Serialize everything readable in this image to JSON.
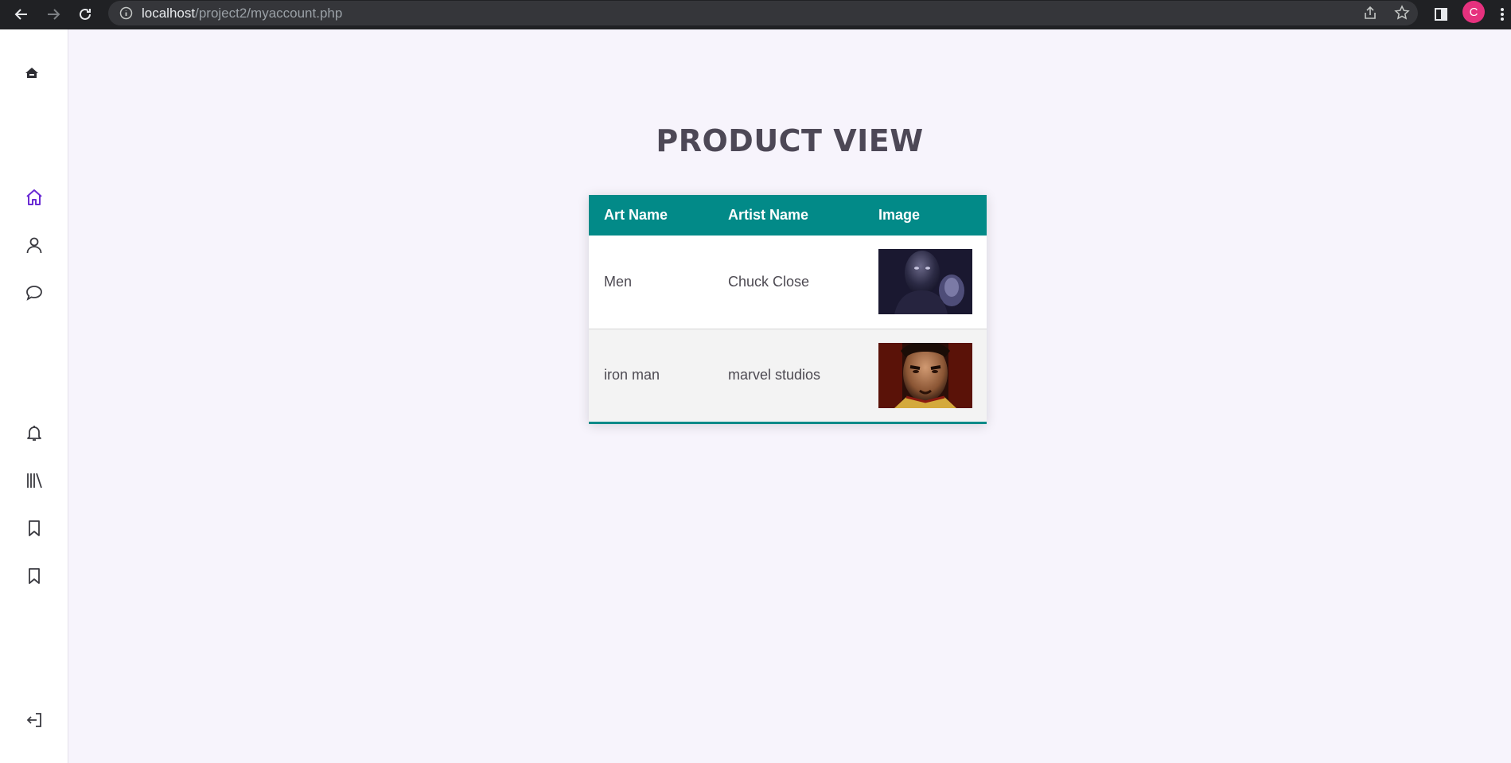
{
  "browser": {
    "url_host": "localhost",
    "url_path": "/project2/myaccount.php",
    "profile_initial": "C",
    "icons": [
      "back-icon",
      "forward-icon",
      "reload-icon",
      "info-icon",
      "share-icon",
      "star-icon",
      "side-panel-icon",
      "menu-icon"
    ]
  },
  "sidebar": {
    "items": [
      {
        "icon": "logo-icon"
      },
      {
        "icon": "home-icon",
        "color": "#6a2bd4"
      },
      {
        "icon": "user-icon"
      },
      {
        "icon": "chat-icon"
      },
      {
        "icon": "bell-icon"
      },
      {
        "icon": "library-icon"
      },
      {
        "icon": "bookmark-icon"
      },
      {
        "icon": "bookmark-icon"
      },
      {
        "icon": "logout-icon"
      }
    ]
  },
  "page": {
    "title": "PRODUCT VIEW"
  },
  "table": {
    "headers": [
      "Art Name",
      "Artist Name",
      "Image"
    ],
    "rows": [
      {
        "art_name": "Men",
        "artist_name": "Chuck Close",
        "image": "portrait-painting-image"
      },
      {
        "art_name": "iron man",
        "artist_name": "marvel studios",
        "image": "iron-man-image"
      }
    ],
    "accent_color": "#028a88"
  }
}
